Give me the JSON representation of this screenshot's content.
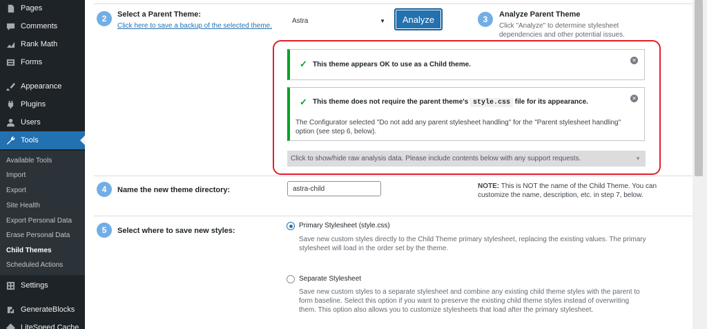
{
  "sidebar": {
    "menu": [
      {
        "label": "Pages",
        "icon": "pages-icon"
      },
      {
        "label": "Comments",
        "icon": "comments-icon"
      },
      {
        "label": "Rank Math",
        "icon": "rank-math-icon"
      },
      {
        "label": "Forms",
        "icon": "forms-icon"
      },
      {
        "label": "Appearance",
        "icon": "appearance-icon"
      },
      {
        "label": "Plugins",
        "icon": "plugins-icon"
      },
      {
        "label": "Users",
        "icon": "users-icon"
      },
      {
        "label": "Tools",
        "icon": "tools-icon"
      },
      {
        "label": "Settings",
        "icon": "settings-icon"
      },
      {
        "label": "GenerateBlocks",
        "icon": "generateblocks-icon"
      },
      {
        "label": "LiteSpeed Cache",
        "icon": "litespeed-icon"
      }
    ],
    "submenu": [
      "Available Tools",
      "Import",
      "Export",
      "Site Health",
      "Export Personal Data",
      "Erase Personal Data",
      "Child Themes",
      "Scheduled Actions"
    ],
    "current_submenu": "Child Themes",
    "accent": "#2271b1"
  },
  "step2": {
    "number": "2",
    "title": "Select a Parent Theme:",
    "backup_link": "Click here to save a backup of the selected theme.",
    "selected_theme": "Astra",
    "analyze_button": "Analyze"
  },
  "step3": {
    "number": "3",
    "title": "Analyze Parent Theme",
    "description_line1": "Click \"Analyze\" to determine stylesheet",
    "description_line2": "dependencies and other potential issues."
  },
  "analysis": {
    "notice1": "This theme appears OK to use as a Child theme.",
    "notice2_before": "This theme does not require the parent theme's",
    "notice2_code": "style.css",
    "notice2_after": "file for its appearance.",
    "notice2_detail_line1": "The Configurator selected \"Do not add any parent stylesheet handling\" for the \"Parent stylesheet handling\"",
    "notice2_detail_line2": "option (see step 6, below).",
    "raw_toggle": "Click to show/hide raw analysis data. Please include contents below with any support requests.",
    "highlight_color": "#e11d2a"
  },
  "step4": {
    "number": "4",
    "title": "Name the new theme directory:",
    "value": "astra-child",
    "note_label": "NOTE:",
    "note_line1": "This is NOT the name of the Child Theme. You can",
    "note_line2": "customize the name, description, etc. in step 7, below."
  },
  "step5": {
    "number": "5",
    "title": "Select where to save new styles:",
    "options": [
      {
        "label": "Primary Stylesheet (style.css)",
        "checked": true,
        "desc_lines": [
          "Save new custom styles directly to the Child Theme primary stylesheet, replacing the existing values. The primary",
          "stylesheet will load in the order set by the theme."
        ]
      },
      {
        "label": "Separate Stylesheet",
        "checked": false,
        "desc_lines": [
          "Save new custom styles to a separate stylesheet and combine any existing child theme styles with the parent to",
          "form baseline. Select this option if you want to preserve the existing child theme styles instead of overwriting",
          "them. This option also allows you to customize stylesheets that load after the primary stylesheet."
        ]
      }
    ]
  }
}
